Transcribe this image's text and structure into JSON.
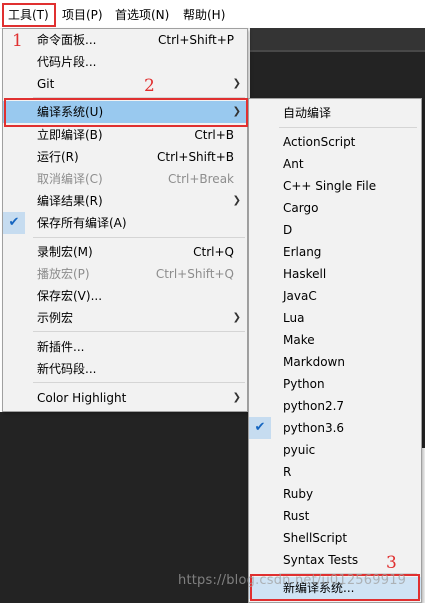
{
  "menubar": {
    "items": [
      {
        "label": "工具(T)"
      },
      {
        "label": "项目(P)"
      },
      {
        "label": "首选项(N)"
      },
      {
        "label": "帮助(H)"
      }
    ]
  },
  "tools_menu": {
    "items": [
      {
        "label": "命令面板...",
        "shortcut": "Ctrl+Shift+P"
      },
      {
        "label": "代码片段..."
      },
      {
        "label": "Git"
      },
      {
        "label": "编译系统(U)"
      },
      {
        "label": "立即编译(B)",
        "shortcut": "Ctrl+B"
      },
      {
        "label": "运行(R)",
        "shortcut": "Ctrl+Shift+B"
      },
      {
        "label": "取消编译(C)",
        "shortcut": "Ctrl+Break"
      },
      {
        "label": "编译结果(R)"
      },
      {
        "label": "保存所有编译(A)"
      },
      {
        "label": "录制宏(M)",
        "shortcut": "Ctrl+Q"
      },
      {
        "label": "播放宏(P)",
        "shortcut": "Ctrl+Shift+Q"
      },
      {
        "label": "保存宏(V)..."
      },
      {
        "label": "示例宏"
      },
      {
        "label": "新插件..."
      },
      {
        "label": "新代码段..."
      },
      {
        "label": "Color Highlight"
      }
    ]
  },
  "build_submenu": {
    "items": [
      {
        "label": "自动编译"
      },
      {
        "label": "ActionScript"
      },
      {
        "label": "Ant"
      },
      {
        "label": "C++ Single File"
      },
      {
        "label": "Cargo"
      },
      {
        "label": "D"
      },
      {
        "label": "Erlang"
      },
      {
        "label": "Haskell"
      },
      {
        "label": "JavaC"
      },
      {
        "label": "Lua"
      },
      {
        "label": "Make"
      },
      {
        "label": "Markdown"
      },
      {
        "label": "Python"
      },
      {
        "label": "python2.7"
      },
      {
        "label": "python3.6"
      },
      {
        "label": "pyuic"
      },
      {
        "label": "R"
      },
      {
        "label": "Ruby"
      },
      {
        "label": "Rust"
      },
      {
        "label": "ShellScript"
      },
      {
        "label": "Syntax Tests"
      },
      {
        "label": "新编译系统..."
      }
    ]
  },
  "annotations": {
    "n1": "1",
    "n2": "2",
    "n3": "3",
    "accent": "#e03030"
  },
  "watermark": "https://blog.csdn.net/u012569919",
  "icons": {
    "check": "check-icon",
    "submenu": "chevron-right-icon"
  }
}
